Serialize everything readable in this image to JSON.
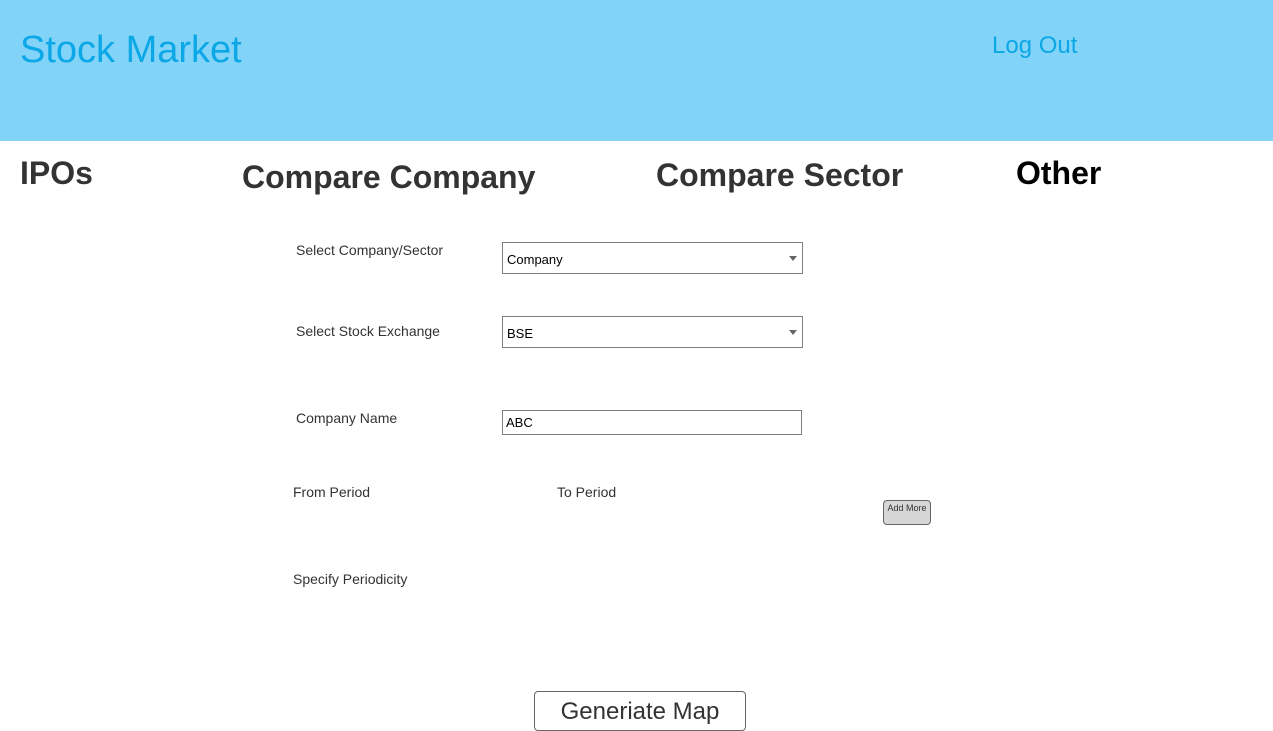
{
  "header": {
    "app_title": "Stock Market",
    "logout_label": "Log Out",
    "background_color": "#81d4f7",
    "text_color": "#0ba7e6"
  },
  "nav": {
    "ipos": "IPOs",
    "compare_company": "Compare Company",
    "compare_sector": "Compare Sector",
    "other": "Other"
  },
  "form": {
    "company_sector_label": "Select Company/Sector",
    "company_sector_value": "Company",
    "stock_exchange_label": "Select Stock Exchange",
    "stock_exchange_value": "BSE",
    "company_name_label": "Company Name",
    "company_name_value": "ABC",
    "from_period_label": "From Period",
    "to_period_label": "To Period",
    "add_more_label": "Add More",
    "periodicity_label": "Specify Periodicity",
    "generate_label": "Generiate Map"
  }
}
